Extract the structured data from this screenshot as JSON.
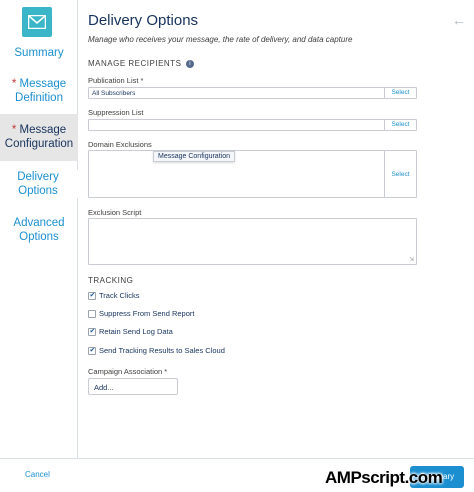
{
  "sidebar": {
    "steps": [
      {
        "label": "Summary",
        "required": false
      },
      {
        "label": "Message Definition",
        "required": true
      },
      {
        "label": "Message Configuration",
        "required": true
      },
      {
        "label": "Delivery Options",
        "required": false
      },
      {
        "label": "Advanced Options",
        "required": false
      }
    ],
    "required_mark": "*"
  },
  "header": {
    "title": "Delivery Options",
    "subtitle": "Manage who receives your message, the rate of delivery, and data capture"
  },
  "recipients": {
    "section_title": "MANAGE RECIPIENTS",
    "info_glyph": "i",
    "publication_label": "Publication List *",
    "publication_value": "All Subscribers",
    "suppression_label": "Suppression List",
    "suppression_value": "",
    "domain_label": "Domain Exclusions",
    "select_label": "Select",
    "tooltip": "Message Configuration",
    "exclusion_label": "Exclusion Script"
  },
  "tracking": {
    "section_title": "TRACKING",
    "options": [
      {
        "label": "Track Clicks",
        "checked": true
      },
      {
        "label": "Suppress From Send Report",
        "checked": false
      },
      {
        "label": "Retain Send Log Data",
        "checked": true
      },
      {
        "label": "Send Tracking Results to Sales Cloud",
        "checked": true
      }
    ],
    "campaign_label": "Campaign Association *",
    "campaign_placeholder": "Add..."
  },
  "footer": {
    "cancel_label": "Cancel",
    "next_label": "Summary"
  },
  "watermark": "AMPscript.com",
  "colors": {
    "accent": "#1b8fd0",
    "logo_bg": "#3bb6c8",
    "required": "#c23934",
    "text": "#16325c"
  }
}
